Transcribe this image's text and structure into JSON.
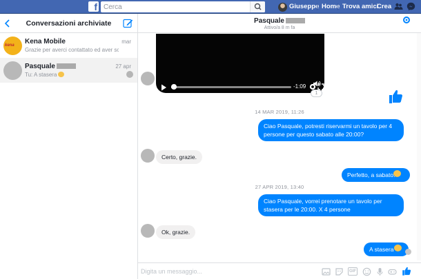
{
  "topbar": {
    "search_placeholder": "Cerca",
    "user_name": "Giuseppe",
    "home_label": "Home",
    "find_friends_label": "Trova amici",
    "create_label": "Crea",
    "accent_color": "#4267b2"
  },
  "sidebar": {
    "title": "Conversazioni archiviate",
    "conversations": [
      {
        "name": "Kena Mobile",
        "snippet": "Grazie per averci contattato ed aver scelt...",
        "date": "mar",
        "avatar_text": "kena"
      },
      {
        "name": "Pasquale",
        "snippet": "Tu: A stasera",
        "date": "27 apr"
      }
    ]
  },
  "chat": {
    "contact_name": "Pasquale",
    "status": "Attivo/a 8 m fa",
    "video": {
      "time": "-1:09",
      "progress_fraction": 0.01
    },
    "reaction_count": "1",
    "timestamps": [
      "14 MAR 2019, 11:26",
      "27 APR 2019, 13:40"
    ],
    "messages": [
      {
        "from": "me",
        "text": "Ciao Pasquale, potresti riservarmi un tavolo per 4 persone per questo sabato alle 20:00?"
      },
      {
        "from": "them",
        "text": "Certo, grazie."
      },
      {
        "from": "me",
        "text": "Perfetto, a sabato!"
      },
      {
        "from": "me",
        "text": "Ciao Pasquale, vorrei prenotare un tavolo per stasera per le 20:00. X 4 persone"
      },
      {
        "from": "them",
        "text": "Ok, grazie."
      },
      {
        "from": "me",
        "text": "A stasera"
      }
    ],
    "composer_placeholder": "Digita un messaggio...",
    "gif_label": "GIF",
    "bubble_color": "#0084ff"
  }
}
